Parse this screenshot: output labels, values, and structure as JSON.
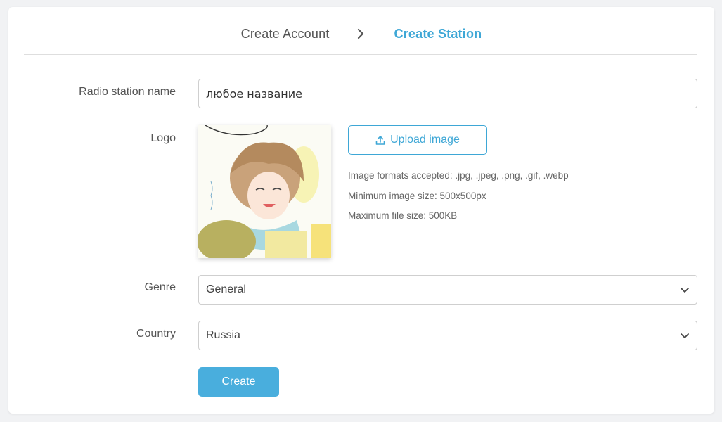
{
  "steps": {
    "step1": "Create Account",
    "step2": "Create Station",
    "active_color": "#3ea7d6"
  },
  "form": {
    "station_name_label": "Radio station name",
    "station_name_value": "любое название",
    "logo_label": "Logo",
    "upload_label": "Upload image",
    "hints": [
      "Image formats accepted: .jpg, .jpeg, .png, .gif, .webp",
      "Minimum image size: 500x500px",
      "Maximum file size: 500KB"
    ],
    "genre_label": "Genre",
    "genre_value": "General",
    "country_label": "Country",
    "country_value": "Russia",
    "create_label": "Create"
  },
  "icons": {
    "step_separator": "chevron-right-icon",
    "upload": "upload-icon",
    "select": "chevron-down-icon"
  }
}
